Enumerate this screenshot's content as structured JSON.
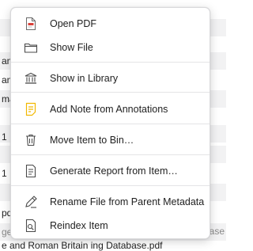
{
  "background": {
    "rows": [
      {
        "text": "",
        "alt": false
      },
      {
        "text": "",
        "alt": true
      },
      {
        "text": "",
        "alt": false
      },
      {
        "text": "anc",
        "alt": true
      },
      {
        "text": "anc",
        "alt": false
      },
      {
        "text": "ma",
        "alt": true
      },
      {
        "text": "",
        "alt": false
      },
      {
        "text": "",
        "alt": true
      },
      {
        "text": "1",
        "alt": false
      },
      {
        "text": "",
        "alt": true
      },
      {
        "text": "1",
        "alt": false
      },
      {
        "text": "",
        "alt": true
      },
      {
        "text": "pdf",
        "alt": false
      },
      {
        "text": "ge",
        "alt": true
      }
    ],
    "right_text": "ibase",
    "bottom_text": "e and Roman Britain ing Database.pdf"
  },
  "menu": {
    "items": [
      {
        "id": "open-pdf",
        "label": "Open PDF",
        "icon": "pdf-file-icon"
      },
      {
        "id": "show-file",
        "label": "Show File",
        "icon": "folder-icon"
      },
      {
        "id": "show-in-library",
        "label": "Show in Library",
        "icon": "library-icon"
      },
      {
        "id": "add-note",
        "label": "Add Note from Annotations",
        "icon": "note-icon"
      },
      {
        "id": "move-to-bin",
        "label": "Move Item to Bin…",
        "icon": "trash-icon"
      },
      {
        "id": "generate-report",
        "label": "Generate Report from Item…",
        "icon": "report-icon"
      },
      {
        "id": "rename-file",
        "label": "Rename File from Parent Metadata",
        "icon": "rename-icon"
      },
      {
        "id": "reindex-item",
        "label": "Reindex Item",
        "icon": "reindex-icon"
      }
    ]
  },
  "colors": {
    "pdf_red": "#d9413a",
    "note_yellow": "#f1b800",
    "icon_gray": "#4a4a4a"
  }
}
